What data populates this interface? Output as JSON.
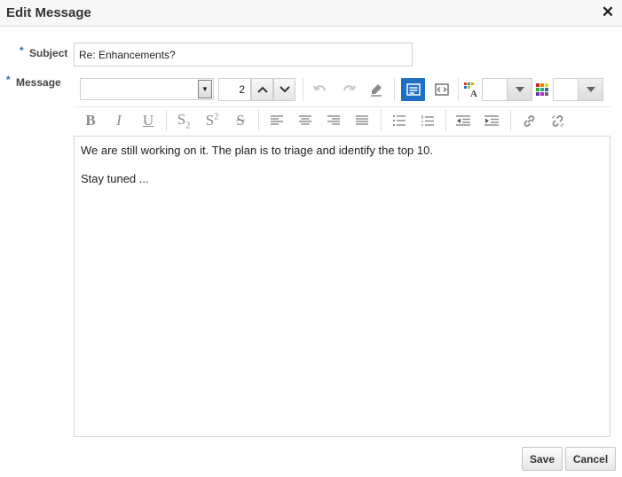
{
  "dialog": {
    "title": "Edit Message",
    "close_glyph": "✕",
    "required_marker": "*"
  },
  "form": {
    "subject_label": "Subject",
    "subject_value": "Re: Enhancements?",
    "message_label": "Message"
  },
  "toolbar": {
    "font_family_value": "",
    "font_size_value": "2",
    "icons": {
      "dropdown": "chevron-down-icon",
      "increase": "chevron-up-icon",
      "decrease": "chevron-down-icon",
      "undo": "undo-icon",
      "redo": "redo-icon",
      "clear": "eraser-icon",
      "rich_text": "rich-text-mode-icon",
      "source": "source-code-mode-icon",
      "text_color": "text-color-icon",
      "bg_color": "background-color-icon",
      "link": "link-icon",
      "unlink": "unlink-icon"
    },
    "format": {
      "bold": "B",
      "italic": "I",
      "underline": "U",
      "subscript": "S",
      "subscript_mark": "2",
      "superscript": "S",
      "superscript_mark": "2",
      "strikethrough": "S"
    },
    "colors": {
      "active_mode": "#1f6fc2",
      "icon_grey": "#8a8a8a"
    }
  },
  "editor": {
    "paragraphs": [
      "We are still working on it. The plan is to triage and identify the top 10.",
      "Stay tuned ..."
    ]
  },
  "actions": {
    "save_label": "Save",
    "cancel_label": "Cancel"
  }
}
